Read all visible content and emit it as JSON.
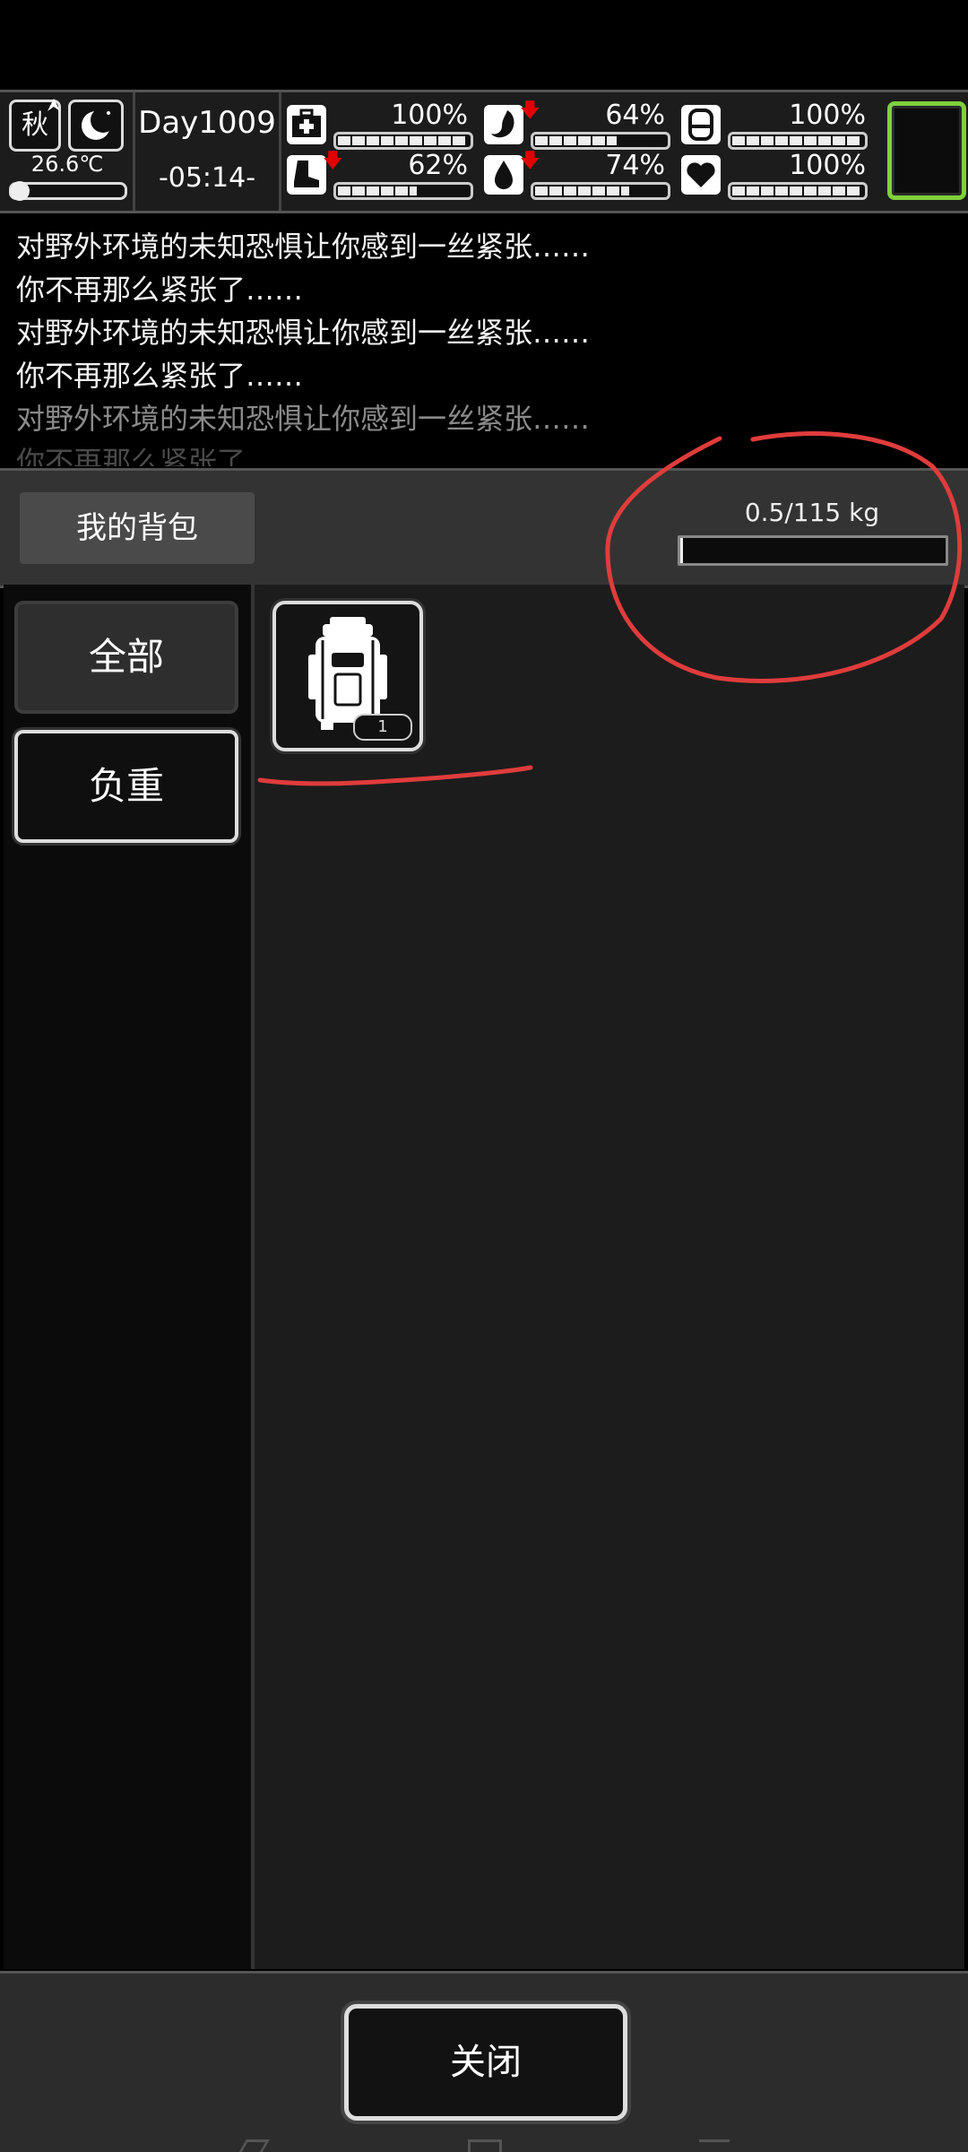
{
  "hud": {
    "season": "秋",
    "temperature": "26.6℃",
    "day": "Day1009",
    "time": "-05:14-",
    "stats": [
      {
        "icon": "medkit-icon",
        "value": "100%",
        "level": 1.0,
        "arrow": false
      },
      {
        "icon": "stomach-icon",
        "value": "64%",
        "level": 0.64,
        "arrow": true
      },
      {
        "icon": "battery-icon",
        "value": "100%",
        "level": 1.0,
        "arrow": false
      },
      {
        "icon": "boot-icon",
        "value": "62%",
        "level": 0.62,
        "arrow": true
      },
      {
        "icon": "water-drop-icon",
        "value": "74%",
        "level": 0.74,
        "arrow": true
      },
      {
        "icon": "heart-icon",
        "value": "100%",
        "level": 1.0,
        "arrow": false
      }
    ],
    "arrow_color": "#e00000",
    "slot_border_color": "#7fd13b"
  },
  "log": [
    "对野外环境的未知恐惧让你感到一丝紧张……",
    "你不再那么紧张了……",
    "对野外环境的未知恐惧让你感到一丝紧张……",
    "你不再那么紧张了……",
    "对野外环境的未知恐惧让你感到一丝紧张……",
    "你不再那么紧张了……"
  ],
  "inventory": {
    "title": "我的背包",
    "weight_text": "0.5/115 kg",
    "weight_fraction": 0.0043,
    "tabs": [
      "全部",
      "负重"
    ],
    "items": [
      {
        "icon": "backpack-icon",
        "count": "1"
      }
    ]
  },
  "footer": {
    "close_label": "关闭"
  },
  "annotation_color": "#e03c3c"
}
